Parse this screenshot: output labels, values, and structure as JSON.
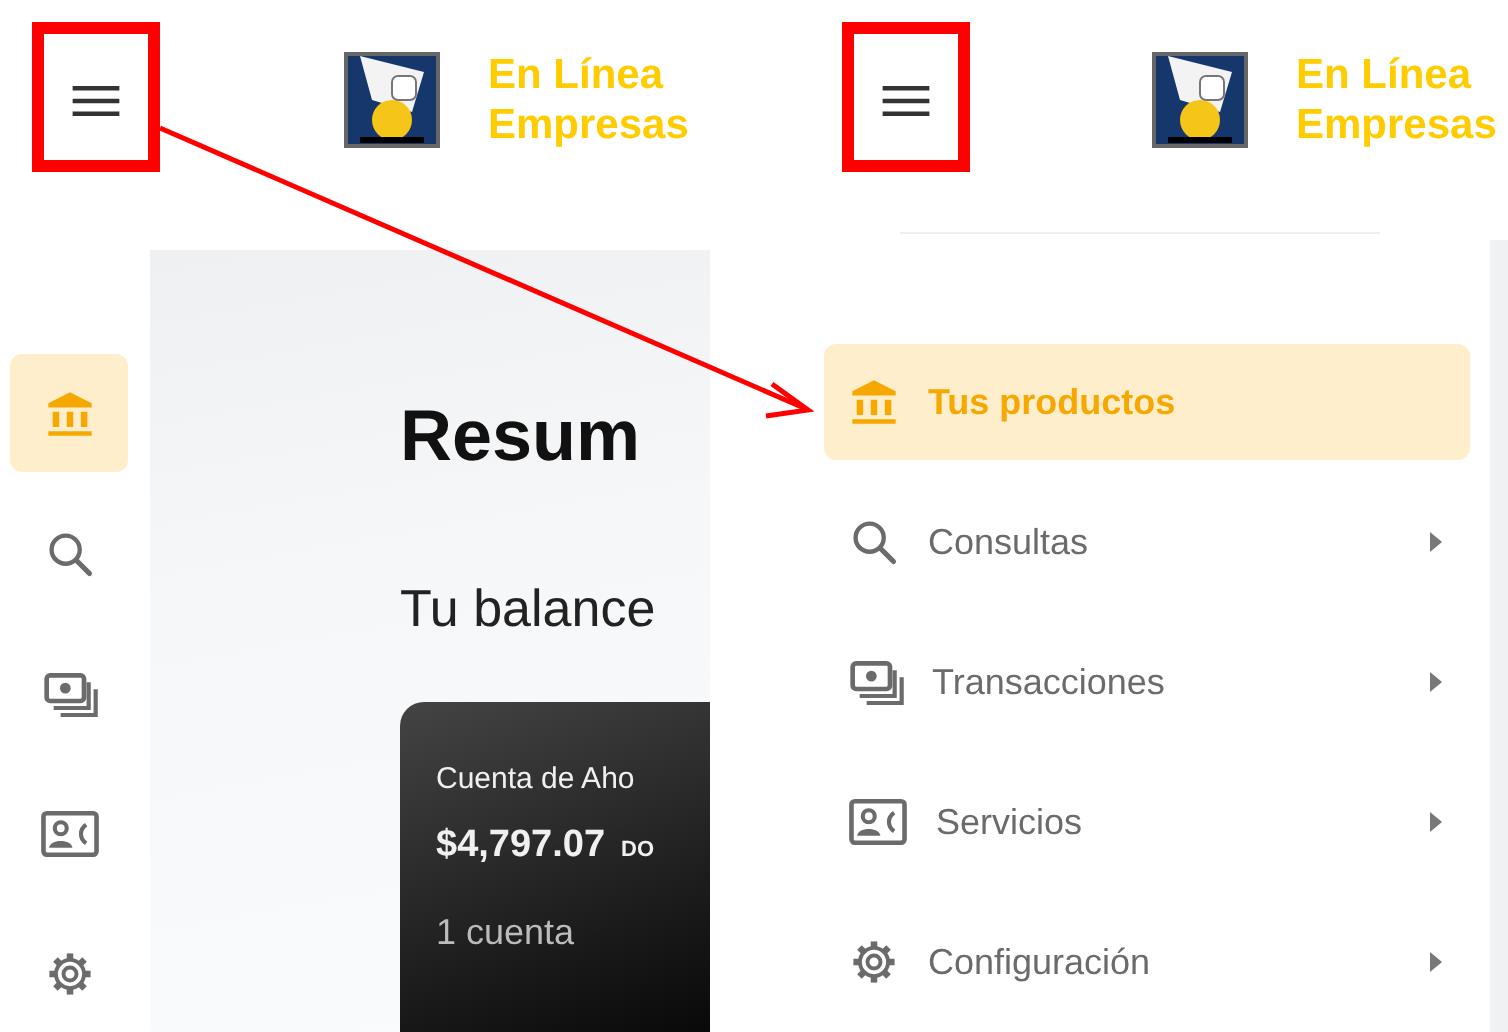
{
  "screens": [
    {
      "header": {
        "brand": [
          "En Línea",
          "Empresas"
        ]
      },
      "rail": [
        {
          "kind": "bank",
          "selected": true
        },
        {
          "kind": "search",
          "selected": false
        },
        {
          "kind": "money",
          "selected": false
        },
        {
          "kind": "contact",
          "selected": false
        },
        {
          "kind": "gear",
          "selected": false
        }
      ],
      "content": {
        "title": "Resum",
        "subtitle": "Tu balance",
        "card": {
          "name": "Cuenta de Aho",
          "amount": "$4,797.07",
          "currency": "DO",
          "count": "1 cuenta"
        }
      }
    },
    {
      "header": {
        "brand": [
          "En Línea",
          "Empresas"
        ]
      },
      "menu": [
        {
          "kind": "bank",
          "label": "Tus productos",
          "selected": true,
          "has_submenu": false
        },
        {
          "kind": "search",
          "label": "Consultas",
          "selected": false,
          "has_submenu": true
        },
        {
          "kind": "money",
          "label": "Transacciones",
          "selected": false,
          "has_submenu": true
        },
        {
          "kind": "contact",
          "label": "Servicios",
          "selected": false,
          "has_submenu": true
        },
        {
          "kind": "gear",
          "label": "Configuración",
          "selected": false,
          "has_submenu": true
        }
      ]
    }
  ]
}
